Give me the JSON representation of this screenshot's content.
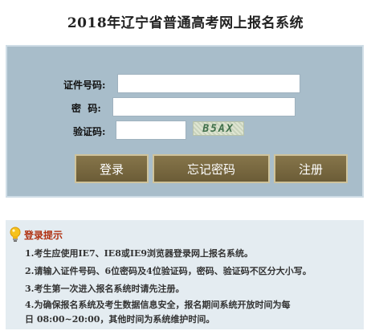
{
  "page": {
    "title": "2018年辽宁省普通高考网上报名系统"
  },
  "form": {
    "id_label": "证件号码:",
    "id_value": "",
    "password_label": "密  码:",
    "password_value": "",
    "captcha_label": "验证码:",
    "captcha_value": "",
    "captcha_text": "B5AX"
  },
  "buttons": {
    "login": "登录",
    "forgot_password": "忘记密码",
    "register": "注册"
  },
  "hint": {
    "icon": "lightbulb-icon",
    "title": "登录提示",
    "lines": [
      "1.考生应使用IE7、IE8或IE9浏览器登录网上报名系统。",
      "2.请输入证件号码、6位密码及4位验证码，密码、验证码不区分大小写。",
      "3.考生第一次进入报名系统时请先注册。",
      "4.为确保报名系统及考生数据信息安全，报名期间系统开放时间为每",
      "日 08:00~20:00，其他时间为系统维护时间。"
    ]
  },
  "colors": {
    "panel": "#a8bdca",
    "button": "#776741",
    "hint_background": "#e4ecf1",
    "hint_title": "#b03010"
  }
}
